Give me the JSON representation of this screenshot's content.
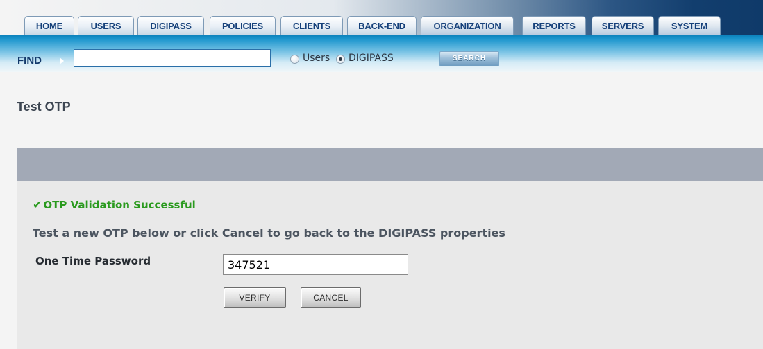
{
  "nav": {
    "tabs": [
      {
        "label": "HOME"
      },
      {
        "label": "USERS"
      },
      {
        "label": "DIGIPASS"
      },
      {
        "label": "POLICIES"
      },
      {
        "label": "CLIENTS"
      },
      {
        "label": "BACK-END"
      },
      {
        "label": "ORGANIZATION"
      },
      {
        "label": "REPORTS"
      },
      {
        "label": "SERVERS"
      },
      {
        "label": "SYSTEM"
      }
    ]
  },
  "find": {
    "label": "FIND",
    "query": "",
    "options": [
      {
        "label": "Users",
        "checked": false
      },
      {
        "label": "DIGIPASS",
        "checked": true
      }
    ],
    "search_label": "SEARCH"
  },
  "page": {
    "title": "Test OTP"
  },
  "result": {
    "status_icon": "check-icon",
    "message": "OTP Validation Successful",
    "status_color": "#2a9a1e",
    "instructions": "Test a new OTP below or click Cancel to go back to the DIGIPASS properties"
  },
  "form": {
    "otp_label": "One Time Password",
    "otp_value": "347521",
    "verify_label": "VERIFY",
    "cancel_label": "CANCEL"
  }
}
